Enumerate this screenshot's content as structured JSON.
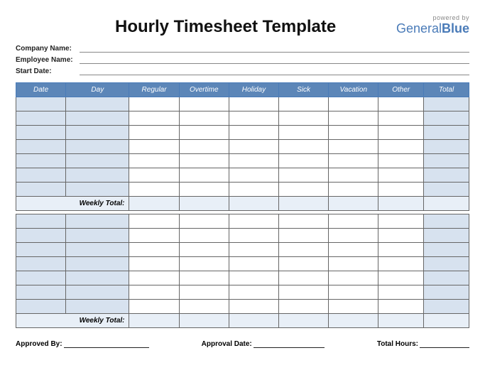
{
  "header": {
    "title": "Hourly Timesheet Template",
    "powered_by": "powered by",
    "brand_a": "General",
    "brand_b": "Blue"
  },
  "fields": {
    "company_label": "Company Name:",
    "employee_label": "Employee Name:",
    "startdate_label": "Start Date:"
  },
  "columns": {
    "date": "Date",
    "day": "Day",
    "regular": "Regular",
    "overtime": "Overtime",
    "holiday": "Holiday",
    "sick": "Sick",
    "vacation": "Vacation",
    "other": "Other",
    "total": "Total"
  },
  "labels": {
    "weekly_total": "Weekly Total:"
  },
  "footer": {
    "approved_by": "Approved By:",
    "approval_date": "Approval Date:",
    "total_hours": "Total Hours:"
  }
}
